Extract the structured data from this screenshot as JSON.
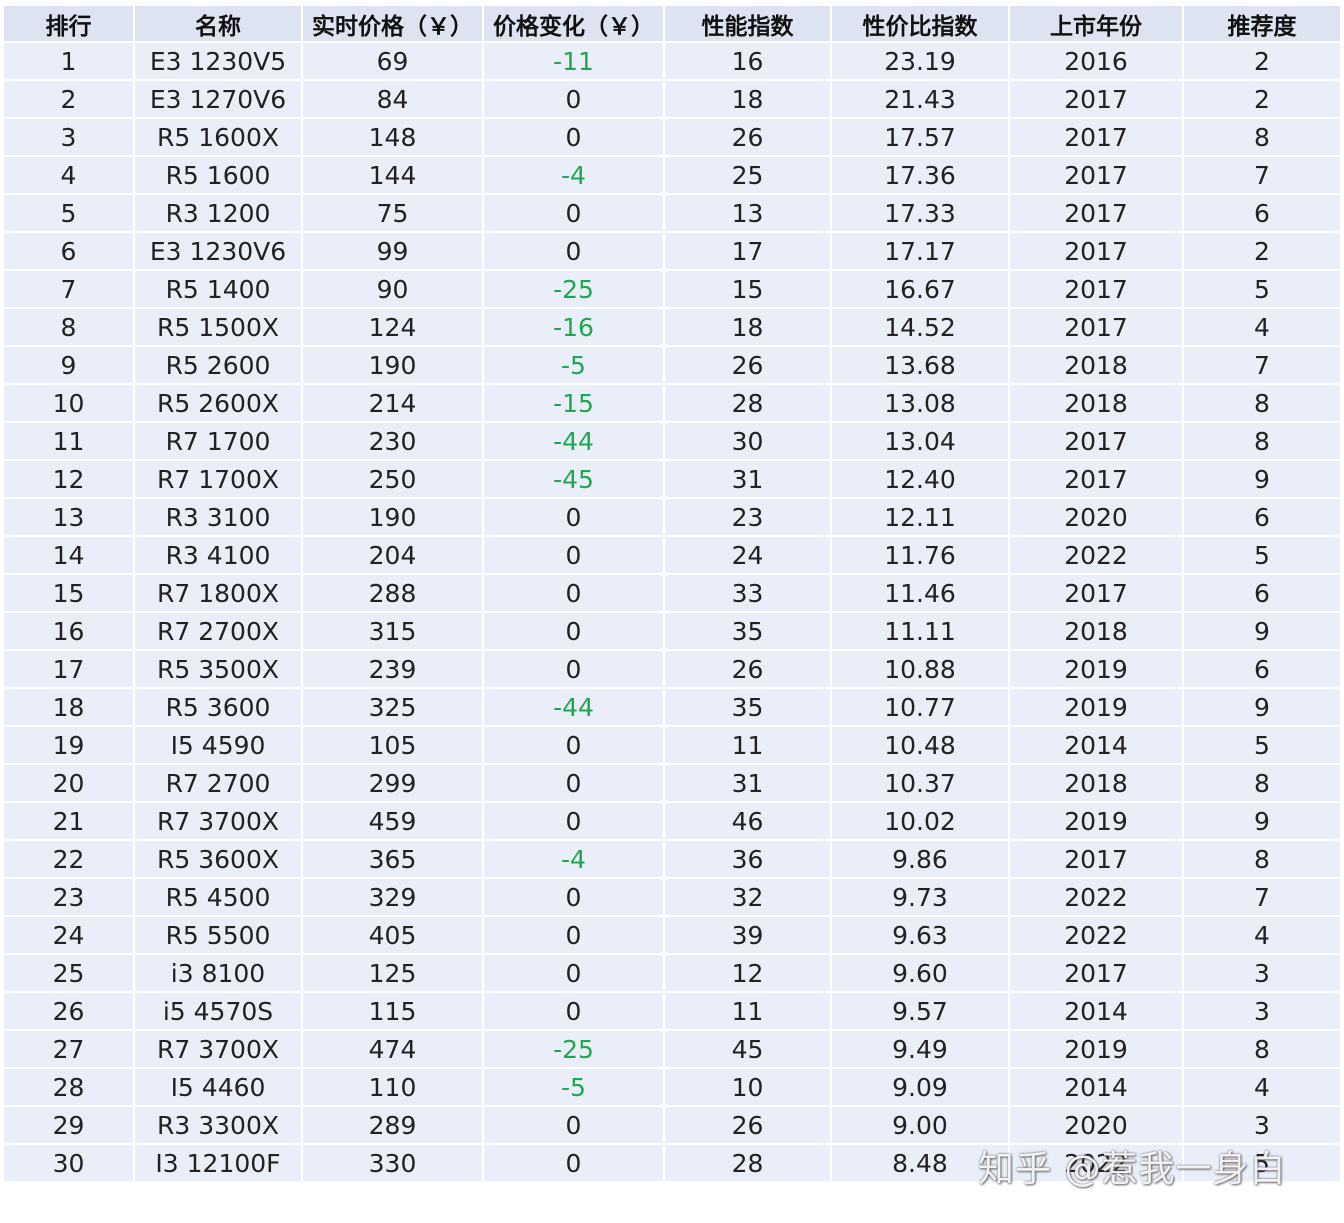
{
  "table": {
    "headers": [
      "排行",
      "名称",
      "实时价格（￥）",
      "价格变化（￥）",
      "性能指数",
      "性价比指数",
      "上市年份",
      "推荐度"
    ],
    "rows": [
      [
        "1",
        "E3 1230V5",
        "69",
        "-11",
        "16",
        "23.19",
        "2016",
        "2"
      ],
      [
        "2",
        "E3 1270V6",
        "84",
        "0",
        "18",
        "21.43",
        "2017",
        "2"
      ],
      [
        "3",
        "R5 1600X",
        "148",
        "0",
        "26",
        "17.57",
        "2017",
        "8"
      ],
      [
        "4",
        "R5 1600",
        "144",
        "-4",
        "25",
        "17.36",
        "2017",
        "7"
      ],
      [
        "5",
        "R3 1200",
        "75",
        "0",
        "13",
        "17.33",
        "2017",
        "6"
      ],
      [
        "6",
        "E3 1230V6",
        "99",
        "0",
        "17",
        "17.17",
        "2017",
        "2"
      ],
      [
        "7",
        "R5 1400",
        "90",
        "-25",
        "15",
        "16.67",
        "2017",
        "5"
      ],
      [
        "8",
        "R5 1500X",
        "124",
        "-16",
        "18",
        "14.52",
        "2017",
        "4"
      ],
      [
        "9",
        "R5 2600",
        "190",
        "-5",
        "26",
        "13.68",
        "2018",
        "7"
      ],
      [
        "10",
        "R5 2600X",
        "214",
        "-15",
        "28",
        "13.08",
        "2018",
        "8"
      ],
      [
        "11",
        "R7 1700",
        "230",
        "-44",
        "30",
        "13.04",
        "2017",
        "8"
      ],
      [
        "12",
        "R7 1700X",
        "250",
        "-45",
        "31",
        "12.40",
        "2017",
        "9"
      ],
      [
        "13",
        "R3 3100",
        "190",
        "0",
        "23",
        "12.11",
        "2020",
        "6"
      ],
      [
        "14",
        "R3 4100",
        "204",
        "0",
        "24",
        "11.76",
        "2022",
        "5"
      ],
      [
        "15",
        "R7 1800X",
        "288",
        "0",
        "33",
        "11.46",
        "2017",
        "6"
      ],
      [
        "16",
        "R7 2700X",
        "315",
        "0",
        "35",
        "11.11",
        "2018",
        "9"
      ],
      [
        "17",
        "R5 3500X",
        "239",
        "0",
        "26",
        "10.88",
        "2019",
        "6"
      ],
      [
        "18",
        "R5 3600",
        "325",
        "-44",
        "35",
        "10.77",
        "2019",
        "9"
      ],
      [
        "19",
        "I5 4590",
        "105",
        "0",
        "11",
        "10.48",
        "2014",
        "5"
      ],
      [
        "20",
        "R7 2700",
        "299",
        "0",
        "31",
        "10.37",
        "2018",
        "8"
      ],
      [
        "21",
        "R7 3700X",
        "459",
        "0",
        "46",
        "10.02",
        "2019",
        "9"
      ],
      [
        "22",
        "R5 3600X",
        "365",
        "-4",
        "36",
        "9.86",
        "2017",
        "8"
      ],
      [
        "23",
        "R5 4500",
        "329",
        "0",
        "32",
        "9.73",
        "2022",
        "7"
      ],
      [
        "24",
        "R5 5500",
        "405",
        "0",
        "39",
        "9.63",
        "2022",
        "4"
      ],
      [
        "25",
        "i3 8100",
        "125",
        "0",
        "12",
        "9.60",
        "2017",
        "3"
      ],
      [
        "26",
        "i5 4570S",
        "115",
        "0",
        "11",
        "9.57",
        "2014",
        "3"
      ],
      [
        "27",
        "R7 3700X",
        "474",
        "-25",
        "45",
        "9.49",
        "2019",
        "8"
      ],
      [
        "28",
        "I5 4460",
        "110",
        "-5",
        "10",
        "9.09",
        "2014",
        "4"
      ],
      [
        "29",
        "R3 3300X",
        "289",
        "0",
        "26",
        "9.00",
        "2020",
        "3"
      ],
      [
        "30",
        "I3 12100F",
        "330",
        "0",
        "28",
        "8.48",
        "2022",
        "5"
      ]
    ]
  },
  "colors": {
    "header_bg": "#dde3f0",
    "cell_bg": "#e9eef8",
    "negative_text": "#1fa84f"
  },
  "watermark": "知乎 @惹我一身白"
}
